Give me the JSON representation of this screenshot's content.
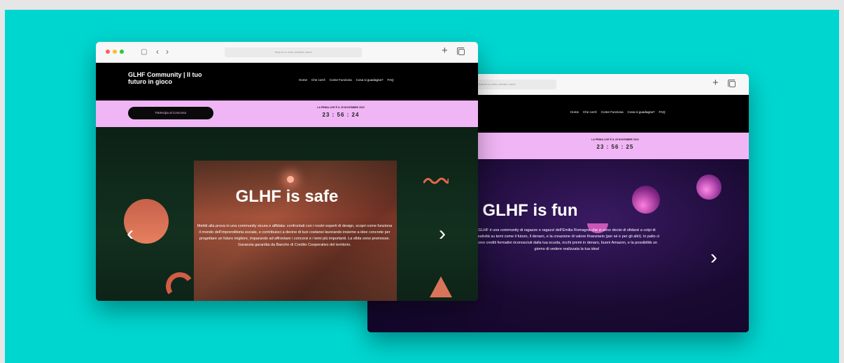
{
  "colors": {
    "background": "#00d6d0",
    "nav": "#000000",
    "countdown_bar": "#f0b5f5",
    "accent": "#e2674a",
    "violet": "#1a0a33"
  },
  "browser": {
    "dots": [
      "#ff5f57",
      "#febc2e",
      "#28c840"
    ],
    "sidebar_icon": "sidebar-icon",
    "back_icon": "chevron-left-icon",
    "forward_icon": "chevron-right-icon",
    "address_placeholder": "Search or enter website name",
    "new_tab_icon": "plus-icon",
    "tabs_icon": "copy-icon"
  },
  "site": {
    "brand": "GLHF Community | Il tuo futuro in gioco",
    "nav": [
      "Home",
      "Che cos'è",
      "Come Funziona",
      "Cosa si guadagna?",
      "FAQ"
    ],
    "cta": "Partecipa al Concorso",
    "countdown_title": "LA PRIMA LIVE È IL 25 NOVEMBRE 2022",
    "countdown_front": "23 : 56 : 24",
    "countdown_back": "23 : 56 : 25"
  },
  "slides": {
    "front": {
      "title": "GLHF is safe",
      "text": "Mettiti alla prova in una community sicura e affidata: confrontati con i nostri esperti di design, scopri come funziona il mondo dell'imprenditoria sociale, e contribuisci a decine di tuoi coetanei lavorando insieme a idee concrete per progettare un futuro migliore, imparando ad affrontare i concorsi e i temi più importanti. La sfida sono promosse. Garanzia garantita da Banche di Credito Cooperativo del territorio."
    },
    "back": {
      "title": "GLHF is fun",
      "text": "GLHF è una community di ragazze e ragazzi dell'Emilia Romagna che si sono decisi di sfidarsi a colpi di creatività su temi come il futuro, il denaro, e la creazione di valore finanziario (per sé e per gli altri). In palio ci sono crediti formativi riconosciuti dalla tua scuola, ricchi premi in denaro, buoni Amazon, e la possibilità un giorno di vedere realizzata la tua idea!"
    }
  }
}
